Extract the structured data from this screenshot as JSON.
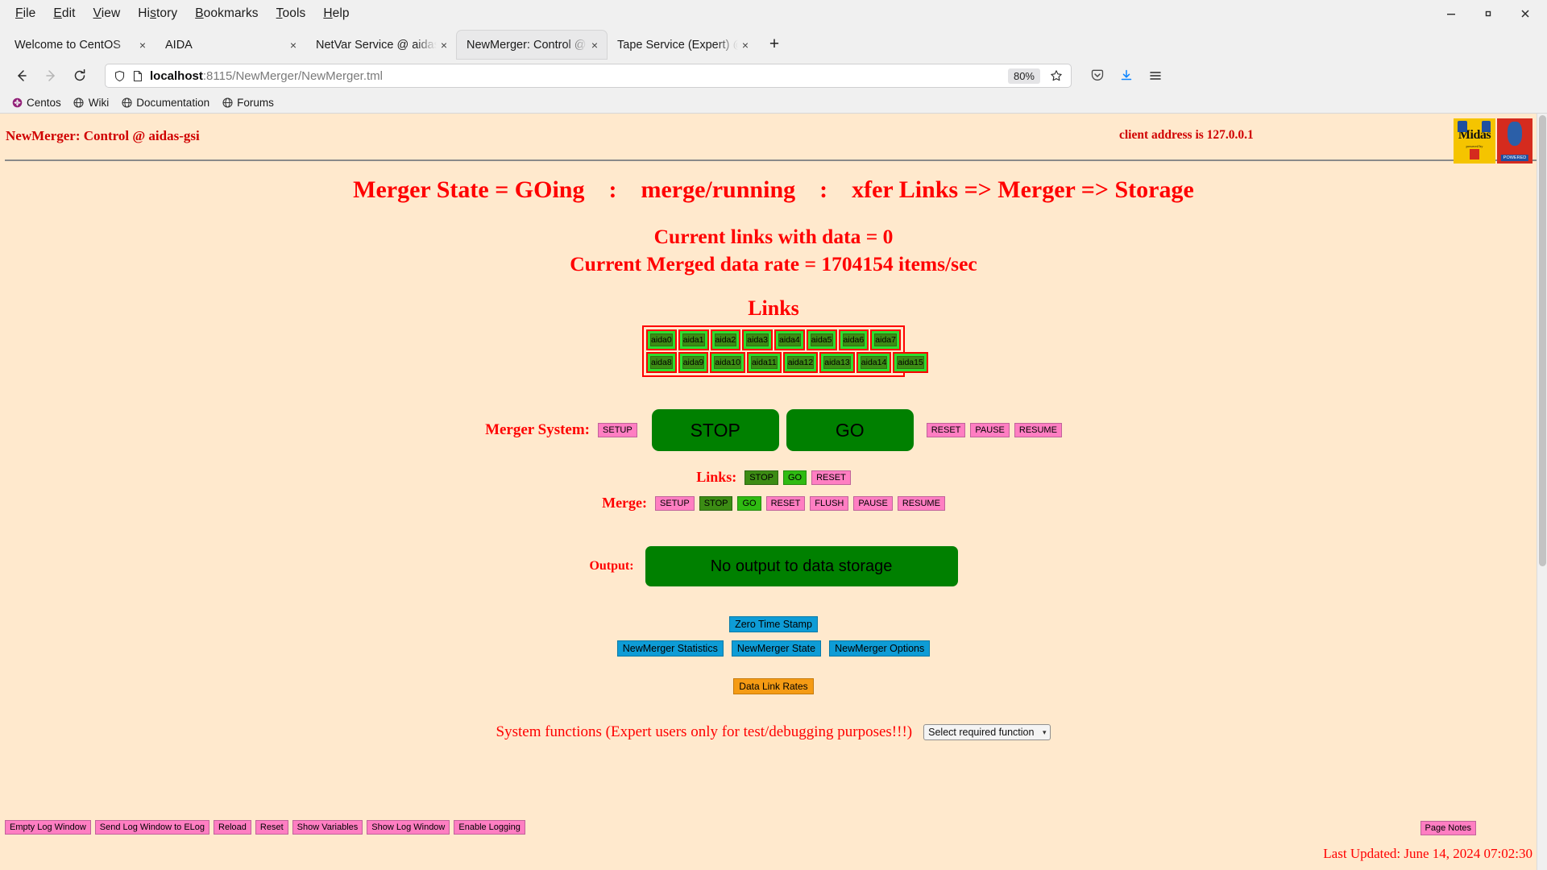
{
  "browser": {
    "menu": [
      {
        "label": "File",
        "accel": "F"
      },
      {
        "label": "Edit",
        "accel": "E"
      },
      {
        "label": "View",
        "accel": "V"
      },
      {
        "label": "History",
        "accel": "s"
      },
      {
        "label": "Bookmarks",
        "accel": "B"
      },
      {
        "label": "Tools",
        "accel": "T"
      },
      {
        "label": "Help",
        "accel": "H"
      }
    ],
    "window_controls": {
      "minimize": "minimize-icon",
      "maximize": "maximize-icon",
      "close": "close-icon"
    },
    "tabs": [
      {
        "title": "Welcome to CentOS",
        "active": false
      },
      {
        "title": "AIDA",
        "active": false
      },
      {
        "title": "NetVar Service @ aidas-gsi",
        "active": false
      },
      {
        "title": "NewMerger: Control @ aidas-gsi",
        "active": true
      },
      {
        "title": "Tape Service (Expert) @ aidas-gsi",
        "active": false
      }
    ],
    "new_tab_label": "+",
    "tab_close_label": "×",
    "nav": {
      "back": "back-arrow-icon",
      "forward": "forward-arrow-icon",
      "reload": "reload-icon"
    },
    "url": {
      "host": "localhost",
      "path": ":8115/NewMerger/NewMerger.tml",
      "full": "localhost:8115/NewMerger/NewMerger.tml"
    },
    "zoom_level": "80%",
    "bookmarks": [
      {
        "label": "Centos",
        "icon": "centos-icon"
      },
      {
        "label": "Wiki",
        "icon": "globe-icon"
      },
      {
        "label": "Documentation",
        "icon": "globe-icon"
      },
      {
        "label": "Forums",
        "icon": "globe-icon"
      }
    ]
  },
  "page": {
    "header": {
      "title": "NewMerger: Control @ aidas-gsi",
      "client_address": "client address is 127.0.0.1",
      "logo_midas": {
        "word": "Midas",
        "sub": "powered by"
      },
      "logo_tcl": {
        "word": "TCL",
        "powered": "POWERED"
      }
    },
    "state_line": "Merger State = GOing    :    merge/running    :    xfer Links => Merger => Storage",
    "stats": {
      "links_with_data": "Current links with data = 0",
      "merged_rate": "Current Merged data rate = 1704154 items/sec"
    },
    "links": {
      "title": "Links",
      "row1": [
        "aida0",
        "aida1",
        "aida2",
        "aida3",
        "aida4",
        "aida5",
        "aida6",
        "aida7"
      ],
      "row2": [
        "aida8",
        "aida9",
        "aida10",
        "aida11",
        "aida12",
        "aida13",
        "aida14",
        "aida15"
      ]
    },
    "merger_system": {
      "label": "Merger System:",
      "setup": "SETUP",
      "stop": "STOP",
      "go": "GO",
      "reset": "RESET",
      "pause": "PAUSE",
      "resume": "RESUME"
    },
    "links_ctl": {
      "label": "Links:",
      "stop": "STOP",
      "go": "GO",
      "reset": "RESET"
    },
    "merge_ctl": {
      "label": "Merge:",
      "setup": "SETUP",
      "stop": "STOP",
      "go": "GO",
      "reset": "RESET",
      "flush": "FLUSH",
      "pause": "PAUSE",
      "resume": "RESUME"
    },
    "output": {
      "label": "Output:",
      "status": "No output to data storage"
    },
    "action_buttons": {
      "zero_time_stamp": "Zero Time Stamp",
      "statistics": "NewMerger Statistics",
      "state": "NewMerger State",
      "options": "NewMerger Options",
      "data_link_rates": "Data Link Rates"
    },
    "system_functions": {
      "text": "System functions (Expert users only for test/debugging purposes!!!)",
      "select_value": "Select required function",
      "caret": "▾"
    },
    "bottom_buttons": [
      "Empty Log Window",
      "Send Log Window to ELog",
      "Reload",
      "Reset",
      "Show Variables",
      "Show Log Window",
      "Enable Logging"
    ],
    "page_notes": "Page Notes",
    "last_updated": "Last Updated: June 14, 2024 07:02:30"
  },
  "colors": {
    "page_bg": "#ffe9cd",
    "red_text": "#ff0000",
    "dark_red": "#d00000",
    "green_big": "#008000",
    "green_btn": "#2fbb12",
    "green_dark": "#3c8c14",
    "lime": "#2fdd2f",
    "pink": "#ff7ec2",
    "blue": "#0e9cd6",
    "orange": "#f59b14"
  }
}
